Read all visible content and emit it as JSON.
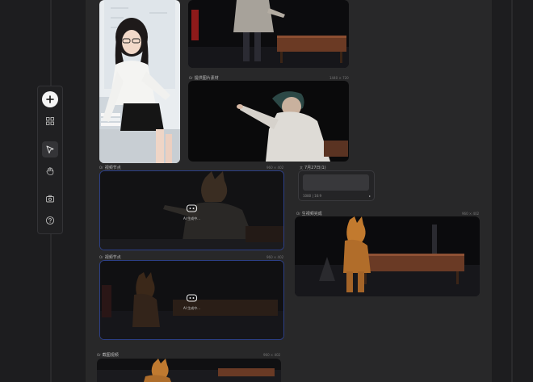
{
  "toolbar": {
    "tools": [
      {
        "name": "add-icon"
      },
      {
        "name": "grid-icon"
      },
      {
        "name": "cursor-icon"
      },
      {
        "name": "hand-icon"
      },
      {
        "name": "camera-icon"
      },
      {
        "name": "help-icon"
      }
    ]
  },
  "nodes": {
    "material": {
      "tag": "Or",
      "label": "提供图片素材",
      "size": "1440 × 720"
    },
    "video_node_1": {
      "tag": "Or",
      "label": "视频节点",
      "size": "960 × 402",
      "status": "AI 生成中..."
    },
    "video_node_2": {
      "tag": "Or",
      "label": "视频节点",
      "size": "960 × 402",
      "status": "AI 生成中..."
    },
    "prompt": {
      "tag": "文",
      "label": "7月27日(1)",
      "footer": "1080 | 16:9",
      "send": "▸"
    },
    "generated": {
      "tag": "Or",
      "label": "生视频完成",
      "size": "960 × 402"
    },
    "crop": {
      "tag": "Or",
      "label": "截图视频",
      "size": "960 × 402"
    }
  },
  "colors": {
    "canvas_bg": "#282829",
    "app_bg": "#1d1d1f",
    "selection_border": "#2c3f86"
  }
}
